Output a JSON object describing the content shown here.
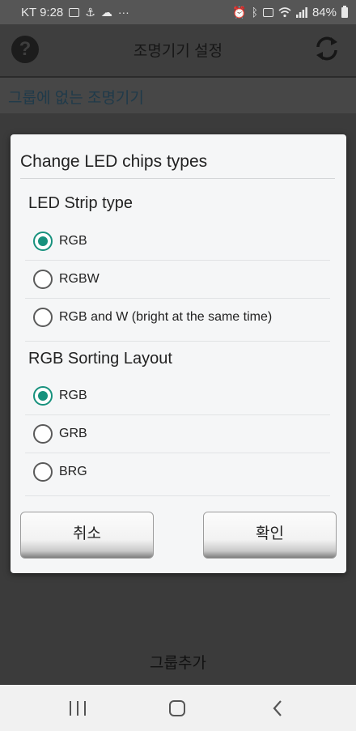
{
  "status_bar": {
    "time": "KT 9:28",
    "more": "···",
    "battery": "84%"
  },
  "app": {
    "title": "조명기기 설정",
    "section_label": "그룹에 없는 조명기기",
    "add_group_label": "그룹추가"
  },
  "dialog": {
    "title": "Change LED chips types",
    "strip_heading": "LED Strip type",
    "strip_options": [
      "RGB",
      "RGBW",
      "RGB and W (bright at the same time)"
    ],
    "strip_selected": "RGB",
    "sorting_heading": "RGB Sorting Layout",
    "sorting_options": [
      "RGB",
      "GRB",
      "BRG"
    ],
    "sorting_selected": "RGB",
    "cancel_label": "취소",
    "ok_label": "확인"
  },
  "colors": {
    "accent": "#17917d",
    "dialog_bg": "#f5f6f7",
    "scrim": "#3d3d3d"
  }
}
